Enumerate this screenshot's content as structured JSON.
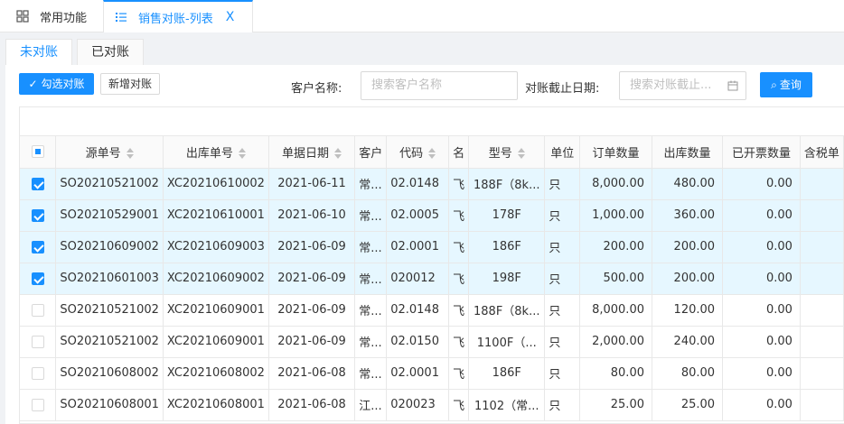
{
  "tabs": {
    "home_label": "常用功能",
    "active_label": "销售对账-列表",
    "close_glyph": "X"
  },
  "subtabs": [
    "未对账",
    "已对账"
  ],
  "toolbar": {
    "select_reconcile": "勾选对账",
    "add_reconcile": "新增对账",
    "query": "查询"
  },
  "filters": {
    "customer_label": "客户名称:",
    "customer_placeholder": "搜索客户名称",
    "date_label": "对账截止日期:",
    "date_placeholder": "搜索对账截止..."
  },
  "table": {
    "headers": [
      "源单号",
      "出库单号",
      "单据日期",
      "客户",
      "代码",
      "名",
      "型号",
      "单位",
      "订单数量",
      "出库数量",
      "已开票数量",
      "含税单"
    ],
    "rows": [
      {
        "checked": true,
        "cells": [
          "SO20210521002",
          "XC20210610002",
          "2021-06-11",
          "常...",
          "02.0148",
          "飞",
          "188F（8k...",
          "只",
          "8,000.00",
          "480.00",
          "0.00"
        ]
      },
      {
        "checked": true,
        "cells": [
          "SO20210529001",
          "XC20210610001",
          "2021-06-10",
          "常...",
          "02.0005",
          "飞",
          "178F",
          "只",
          "1,000.00",
          "360.00",
          "0.00"
        ]
      },
      {
        "checked": true,
        "cells": [
          "SO20210609002",
          "XC20210609003",
          "2021-06-09",
          "常...",
          "02.0001",
          "飞",
          "186F",
          "只",
          "200.00",
          "200.00",
          "0.00"
        ]
      },
      {
        "checked": true,
        "cells": [
          "SO20210601003",
          "XC20210609002",
          "2021-06-09",
          "常...",
          "020012",
          "飞",
          "198F",
          "只",
          "500.00",
          "200.00",
          "0.00"
        ]
      },
      {
        "checked": false,
        "cells": [
          "SO20210521002",
          "XC20210609001",
          "2021-06-09",
          "常...",
          "02.0148",
          "飞",
          "188F（8k...",
          "只",
          "8,000.00",
          "120.00",
          "0.00"
        ]
      },
      {
        "checked": false,
        "cells": [
          "SO20210521002",
          "XC20210609001",
          "2021-06-09",
          "常...",
          "02.0150",
          "飞",
          "1100F（...",
          "只",
          "2,000.00",
          "240.00",
          "0.00"
        ]
      },
      {
        "checked": false,
        "cells": [
          "SO20210608002",
          "XC20210608002",
          "2021-06-08",
          "常...",
          "02.0001",
          "飞",
          "186F",
          "只",
          "80.00",
          "80.00",
          "0.00"
        ]
      },
      {
        "checked": false,
        "cells": [
          "SO20210608001",
          "XC20210608001",
          "2021-06-08",
          "江...",
          "020023",
          "飞",
          "1102（常...",
          "只",
          "25.00",
          "25.00",
          "0.00"
        ]
      }
    ]
  }
}
